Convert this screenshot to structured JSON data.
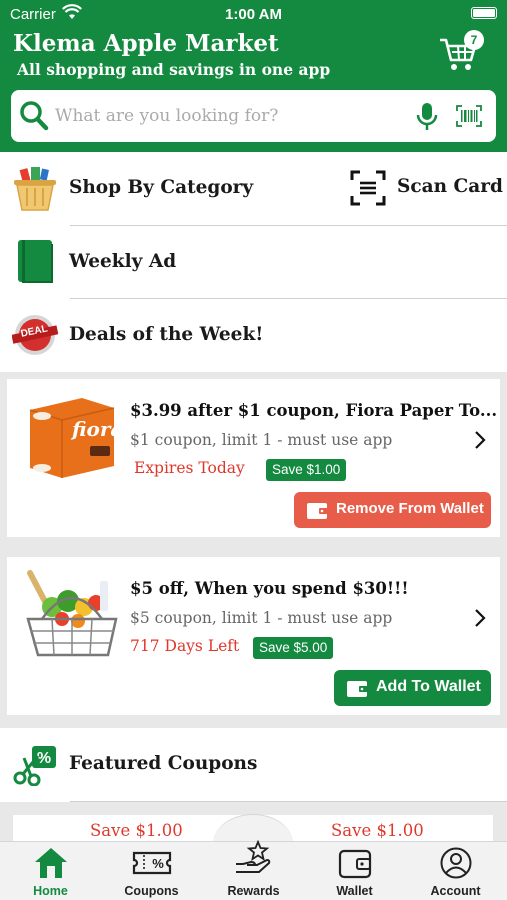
{
  "status_bar": {
    "carrier": "Carrier",
    "time": "1:00 AM"
  },
  "header": {
    "title": "Klema Apple Market",
    "subtitle": "All shopping and savings in one app",
    "cart_count": "7"
  },
  "search": {
    "placeholder": "What are you looking for?"
  },
  "menu": {
    "shop_by_category": "Shop By Category",
    "scan_card": "Scan Card",
    "weekly_ad": "Weekly Ad",
    "deals_of_week": "Deals of the Week!",
    "featured_coupons": "Featured Coupons"
  },
  "deals": [
    {
      "title": "$3.99 after $1 coupon,  Fiora Paper To...",
      "subtitle": "$1 coupon, limit 1 - must use app",
      "expiry": "Expires Today",
      "save": "Save $1.00",
      "button": "Remove From Wallet"
    },
    {
      "title": "$5 off,  When you spend $30!!!",
      "subtitle": "$5 coupon, limit 1 - must use app",
      "expiry": "717 Days Left",
      "save": "Save $5.00",
      "button": "Add To Wallet"
    }
  ],
  "featured_peek": [
    "Save $1.00",
    "Save $1.00"
  ],
  "tabs": [
    {
      "label": "Home",
      "icon": "home-icon",
      "active": true
    },
    {
      "label": "Coupons",
      "icon": "coupon-icon",
      "active": false
    },
    {
      "label": "Rewards",
      "icon": "rewards-icon",
      "active": false
    },
    {
      "label": "Wallet",
      "icon": "wallet-icon",
      "active": false
    },
    {
      "label": "Account",
      "icon": "account-icon",
      "active": false
    }
  ],
  "colors": {
    "brand_green": "#138a3f",
    "alert_red": "#e0372b",
    "remove_button": "#e85c4a"
  }
}
